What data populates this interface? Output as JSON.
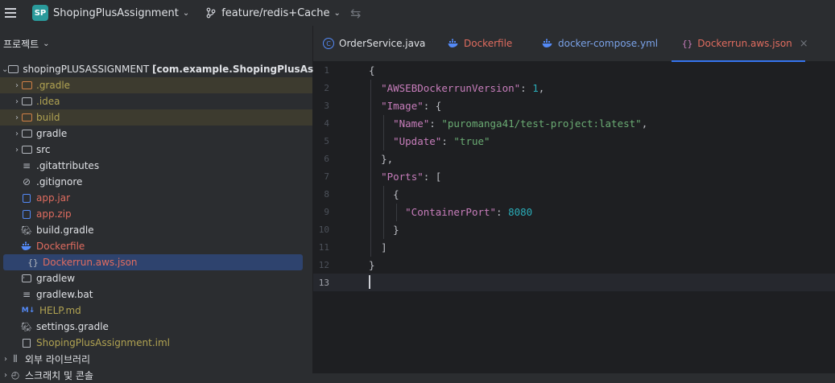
{
  "topbar": {
    "project_badge": "SP",
    "project_name": "ShopingPlusAssignment",
    "branch_name": "feature/redis+Cache"
  },
  "sidebar": {
    "header": "프로젝트",
    "root": "shopingPLUSASSIGNMENT",
    "root_module": "[com.example.ShopingPlusAssignment]",
    "items": [
      {
        "label": ".gradle"
      },
      {
        "label": ".idea"
      },
      {
        "label": "build"
      },
      {
        "label": "gradle"
      },
      {
        "label": "src"
      },
      {
        "label": ".gitattributes"
      },
      {
        "label": ".gitignore"
      },
      {
        "label": "app.jar"
      },
      {
        "label": "app.zip"
      },
      {
        "label": "build.gradle"
      },
      {
        "label": "Dockerfile"
      },
      {
        "label": "Dockerrun.aws.json"
      },
      {
        "label": "gradlew"
      },
      {
        "label": "gradlew.bat"
      },
      {
        "label": "HELP.md"
      },
      {
        "label": "settings.gradle"
      },
      {
        "label": "ShopingPlusAssignment.iml"
      }
    ],
    "external_libraries": "외부 라이브러리",
    "scratches": "스크래치 및 콘솔"
  },
  "tabs": [
    {
      "label": "OrderService.java"
    },
    {
      "label": "Dockerfile"
    },
    {
      "label": "docker-compose.yml"
    },
    {
      "label": "Dockerrun.aws.json",
      "close": "×"
    }
  ],
  "editor": {
    "line_numbers": [
      "1",
      "2",
      "3",
      "4",
      "5",
      "6",
      "7",
      "8",
      "9",
      "10",
      "11",
      "12",
      "13"
    ],
    "code": {
      "l1": "{",
      "l2_key": "\"AWSEBDockerrunVersion\"",
      "l2_val": "1",
      "l3_key": "\"Image\"",
      "l4_key": "\"Name\"",
      "l4_val": "\"puromanga41/test-project:latest\"",
      "l5_key": "\"Update\"",
      "l5_val": "\"true\"",
      "l6": "},",
      "l7_key": "\"Ports\"",
      "l8": "{",
      "l9_key": "\"ContainerPort\"",
      "l9_val": "8080",
      "l10": "}",
      "l11": "]",
      "l12": "}"
    }
  },
  "colors": {
    "accent": "#3574f0",
    "key": "#c77dbb",
    "string": "#6aab73",
    "number": "#2aacb8"
  }
}
